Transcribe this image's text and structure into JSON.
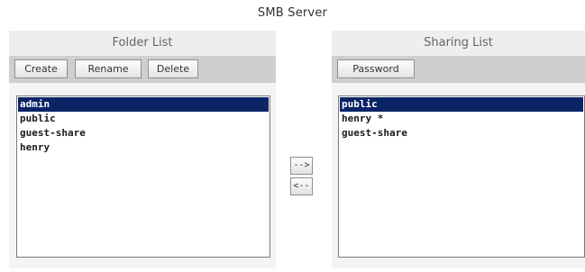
{
  "page": {
    "title": "SMB Server"
  },
  "folder_panel": {
    "title": "Folder List",
    "buttons": {
      "create": "Create",
      "rename": "Rename",
      "delete": "Delete"
    },
    "items": [
      "admin",
      "public",
      "guest-share",
      "henry"
    ],
    "selected": "admin"
  },
  "transfer": {
    "add_label": "-->",
    "remove_label": "<--"
  },
  "sharing_panel": {
    "title": "Sharing List",
    "buttons": {
      "password": "Password"
    },
    "items": [
      "public",
      "henry *",
      "guest-share"
    ],
    "selected": "public"
  },
  "colors": {
    "selection": "#0a2466",
    "toolbar": "#cfcfcf",
    "panel_background": "#f4f4f4"
  }
}
